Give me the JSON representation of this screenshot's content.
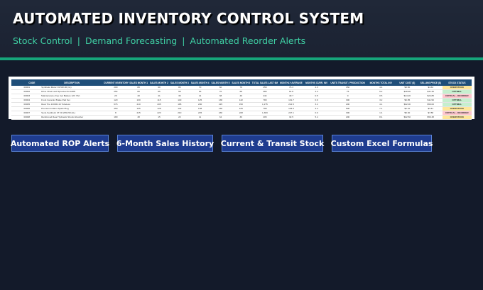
{
  "header": {
    "title": "AUTOMATED INVENTORY CONTROL SYSTEM",
    "subtitle_items": [
      "Stock Control",
      "Demand Forecasting",
      "Automated Reorder Alerts"
    ],
    "separator": "|"
  },
  "spreadsheet": {
    "columns": [
      "CODE",
      "DESCRIPTION",
      "CURRENT INVENTORY",
      "SALES MONTH 1",
      "SALES MONTH 2",
      "SALES MONTH 3",
      "SALES MONTH 4",
      "SALES MONTH 5",
      "SALES MONTH 6",
      "TOTAL SALES LAST 6M",
      "MONTHLY AVERAGE",
      "MONTHS CURR. INV",
      "UNITS TRANSIT / PRODUCTION",
      "MONTHS TOTAL INV",
      "UNIT COST ($)",
      "SELLING PRICE ($)",
      "STOCK STATUS"
    ],
    "rows": [
      [
        "00001",
        "Synthetic Motor Oil 5W-30 (1L)",
        "200",
        "80",
        "90",
        "80",
        "70",
        "60",
        "78",
        "458",
        "76.3",
        "4.3",
        "150",
        "4.4",
        "$3.50",
        "$4.63",
        "OVERSTOCK"
      ],
      [
        "00002",
        "Drive Chain and Sprocket Kit 428H",
        "254",
        "80",
        "85",
        "58",
        "63",
        "70",
        "68",
        "385",
        "61.8",
        "4.4",
        "75",
        "5.2",
        "$18.90",
        "$31.30",
        "OPTIMAL"
      ],
      [
        "00003",
        "Maintenance-Free Gel Battery 12V 7Ah",
        "20",
        "40",
        "41",
        "39",
        "41",
        "38",
        "49",
        "244",
        "40.7",
        "0.5",
        "0",
        "0.5",
        "$14.20",
        "$24.85",
        "CRITICAL - REORDER"
      ],
      [
        "00004",
        "Front Ceramic Brake Pad Set",
        "120",
        "130",
        "115",
        "140",
        "125",
        "138",
        "132",
        "780",
        "131.7",
        "0.9",
        "300",
        "3.2",
        "$6.85",
        "$11.99",
        "OPTIMAL"
      ],
      [
        "00005",
        "Rear Tire 130/90-16 Tubeless",
        "676",
        "210",
        "205",
        "195",
        "200",
        "215",
        "150",
        "1,275",
        "212.5",
        "3.2",
        "200",
        "4.1",
        "$32.00",
        "$56.00",
        "OPTIMAL"
      ],
      [
        "00006",
        "Premium Iridium Spark Plug",
        "450",
        "135",
        "128",
        "142",
        "138",
        "130",
        "125",
        "798",
        "133.0",
        "3.4",
        "500",
        "7.1",
        "$2.10",
        "$3.41",
        "OVERSTOCK"
      ],
      [
        "00007",
        "Semi-Synthetic 4T Oil 20W-50 (1L)",
        "8",
        "215",
        "223",
        "210",
        "245",
        "230",
        "228",
        "1,363",
        "227.1",
        "0.0",
        "300",
        "1.4",
        "$5.30",
        "$7.88",
        "CRITICAL - REORDER"
      ],
      [
        "00008",
        "Reinforced Rear Hydraulic Shock Absorber",
        "180",
        "38",
        "15",
        "20",
        "11",
        "34",
        "36",
        "205",
        "32.5",
        "5.4",
        "200",
        "8.4",
        "$32.50",
        "$56.38",
        "OVERSTOCK"
      ]
    ]
  },
  "buttons": [
    {
      "label": "Automated ROP Alerts"
    },
    {
      "label": "6-Month Sales History"
    },
    {
      "label": "Current & Transit Stock"
    },
    {
      "label": "Custom Excel Formulas"
    }
  ],
  "colors": {
    "background": "#131a2a",
    "accent": "#16a57a",
    "subtitle": "#3fd0a4",
    "button": "#1f3c8f",
    "table_header": "#1f4e79"
  }
}
